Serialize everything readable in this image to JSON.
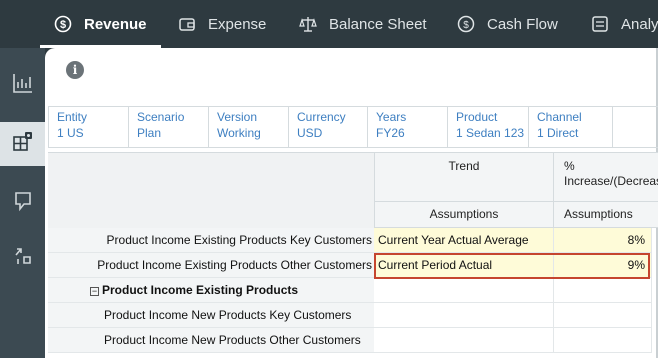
{
  "nav": {
    "tabs": [
      {
        "label": "Revenue",
        "icon": "revenue-icon",
        "active": true
      },
      {
        "label": "Expense",
        "icon": "wallet-icon",
        "active": false
      },
      {
        "label": "Balance Sheet",
        "icon": "scales-icon",
        "active": false
      },
      {
        "label": "Cash Flow",
        "icon": "cash-flow-icon",
        "active": false
      },
      {
        "label": "Analy",
        "icon": "analysis-icon",
        "active": false
      }
    ]
  },
  "rail": {
    "items": [
      {
        "icon": "chart-icon",
        "active": false
      },
      {
        "icon": "grid-form-icon",
        "active": true
      },
      {
        "icon": "flag-icon",
        "active": false
      },
      {
        "icon": "tasks-icon",
        "active": false
      }
    ]
  },
  "info_icon": "i",
  "pov": [
    {
      "label": "Entity",
      "value": "1 US"
    },
    {
      "label": "Scenario",
      "value": "Plan"
    },
    {
      "label": "Version",
      "value": "Working"
    },
    {
      "label": "Currency",
      "value": "USD"
    },
    {
      "label": "Years",
      "value": "FY26"
    },
    {
      "label": "Product",
      "value": "1 Sedan 123"
    },
    {
      "label": "Channel",
      "value": "1 Direct"
    }
  ],
  "grid": {
    "col_headers": [
      "Trend",
      "%\nIncrease/(Decrease)"
    ],
    "sub_headers": [
      "Assumptions",
      "Assumptions"
    ],
    "rows": [
      {
        "label": "Product Income Existing Products Key Customers",
        "trend": "Current Year Actual Average",
        "pct": "8%"
      },
      {
        "label": "Product Income Existing Products Other Customers",
        "trend": "Current Period Actual",
        "pct": "9%"
      },
      {
        "label": "Product Income Existing Products",
        "trend": "",
        "pct": ""
      },
      {
        "label": "Product Income New Products Key Customers",
        "trend": "",
        "pct": ""
      },
      {
        "label": "Product Income New Products Other Customers",
        "trend": "",
        "pct": ""
      }
    ]
  },
  "colors": {
    "nav_bg": "#2e3a40",
    "rail_bg": "#3c4a52",
    "link": "#3e7fc1",
    "input_cell": "#fefbd8",
    "selection": "#c5452e"
  }
}
